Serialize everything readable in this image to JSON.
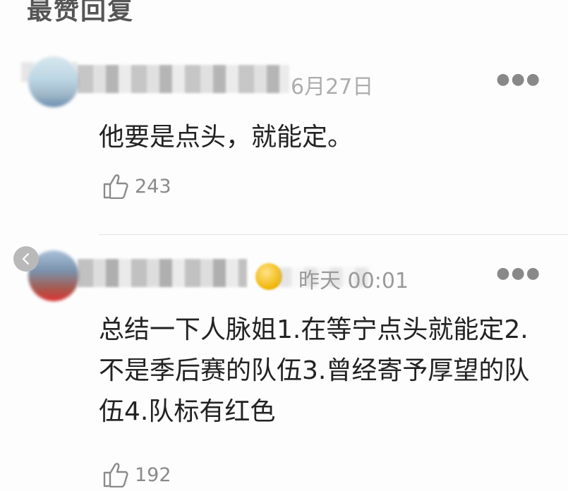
{
  "section": {
    "title": "最赞回复"
  },
  "comments": [
    {
      "date": "6月27日",
      "text": "他要是点头，就能定。",
      "likes": "243"
    },
    {
      "date": "昨天 00:01",
      "text": "总结一下人脉姐1.在等宁点头就能定2.不是季后赛的队伍3.曾经寄予厚望的队伍4.队标有红色",
      "likes": "192"
    }
  ],
  "icons": {
    "more": "more-dots-icon",
    "like": "thumbs-up-icon",
    "back": "chevron-left-icon"
  }
}
